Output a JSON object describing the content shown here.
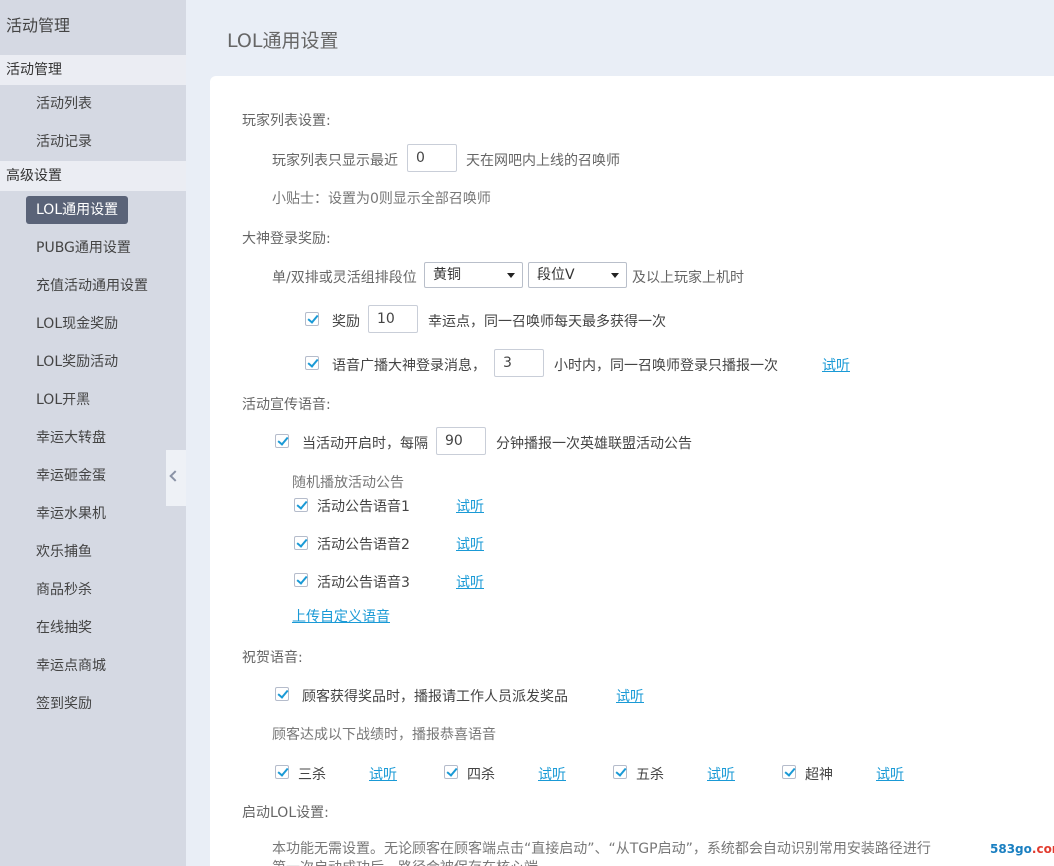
{
  "sidebar": {
    "top_title": "活动管理",
    "section_activity": "活动管理",
    "activity_items": [
      "活动列表",
      "活动记录"
    ],
    "section_advanced": "高级设置",
    "advanced_items": [
      "LOL通用设置",
      "PUBG通用设置",
      "充值活动通用设置",
      "LOL现金奖励",
      "LOL奖励活动",
      "LOL开黑",
      "幸运大转盘",
      "幸运砸金蛋",
      "幸运水果机",
      "欢乐捕鱼",
      "商品秒杀",
      "在线抽奖",
      "幸运点商城",
      "签到奖励"
    ],
    "active_item": "LOL通用设置"
  },
  "page": {
    "title": "LOL通用设置"
  },
  "player_list": {
    "heading": "玩家列表设置:",
    "prefix": "玩家列表只显示最近",
    "days_value": "0",
    "suffix": "天在网吧内上线的召唤师",
    "tip": "小贴士：设置为0则显示全部召唤师"
  },
  "god_login": {
    "heading": "大神登录奖励:",
    "rank_prefix": "单/双排或灵活组排段位",
    "rank_tier_selected": "黄铜",
    "rank_div_selected": "段位Ⅴ",
    "rank_suffix": "及以上玩家上机时",
    "reward_checked": true,
    "reward_label": "奖励",
    "reward_value": "10",
    "reward_suffix": "幸运点，同一召唤师每天最多获得一次",
    "voice_checked": true,
    "voice_label": "语音广播大神登录消息，",
    "voice_hours_value": "3",
    "voice_suffix": "小时内，同一召唤师登录只播报一次",
    "voice_listen": "试听"
  },
  "promo_voice": {
    "heading": "活动宣传语音:",
    "interval_checked": true,
    "interval_prefix": "当活动开启时，每隔",
    "interval_value": "90",
    "interval_suffix": "分钟播报一次英雄联盟活动公告",
    "random_label": "随机播放活动公告",
    "announcements": [
      {
        "label": "活动公告语音1",
        "checked": true,
        "listen": "试听"
      },
      {
        "label": "活动公告语音2",
        "checked": true,
        "listen": "试听"
      },
      {
        "label": "活动公告语音3",
        "checked": true,
        "listen": "试听"
      }
    ],
    "upload_link": "上传自定义语音"
  },
  "congrats_voice": {
    "heading": "祝贺语音:",
    "prize_checked": true,
    "prize_label": "顾客获得奖品时，播报请工作人员派发奖品",
    "prize_listen": "试听",
    "achievement_label": "顾客达成以下战绩时，播报恭喜语音",
    "achievements": [
      {
        "label": "三杀",
        "checked": true,
        "listen": "试听"
      },
      {
        "label": "四杀",
        "checked": true,
        "listen": "试听"
      },
      {
        "label": "五杀",
        "checked": true,
        "listen": "试听"
      },
      {
        "label": "超神",
        "checked": true,
        "listen": "试听"
      }
    ]
  },
  "launch_lol": {
    "heading": "启动LOL设置:",
    "desc_line1": "本功能无需设置。无论顾客在顾客端点击“直接启动”、“从TGP启动”，系统都会自动识别常用安装路径进行",
    "desc_line2": "第一次启动成功后，路径会被保存在核心端"
  },
  "watermark": {
    "main": "583go",
    "suffix": ".com"
  }
}
